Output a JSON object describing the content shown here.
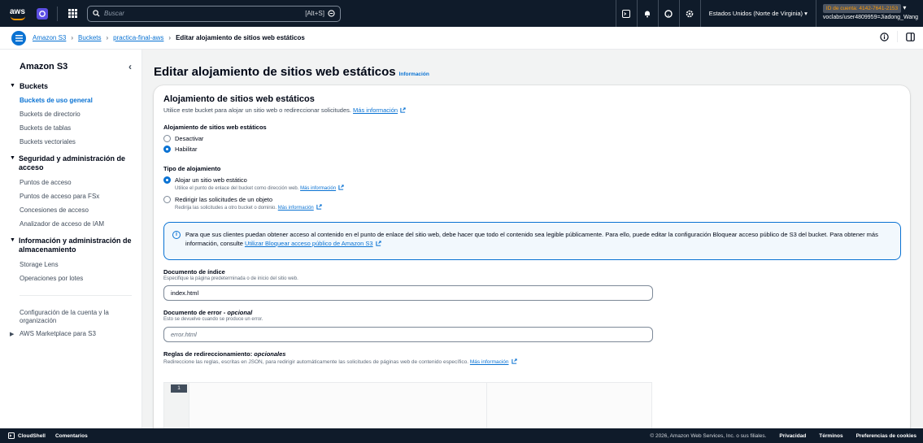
{
  "topbar": {
    "logo": "aws",
    "search_placeholder": "Buscar",
    "search_shortcut": "[Alt+S]",
    "region": "Estados Unidos (Norte de Virginia)",
    "account_id": "ID de cuenta: 4142-7641-2153",
    "account_user": "voclabs/user4809959=Jiadong_Wang"
  },
  "breadcrumb": {
    "items": [
      "Amazon S3",
      "Buckets",
      "practica-final-aws"
    ],
    "current": "Editar alojamiento de sitios web estáticos"
  },
  "sidebar": {
    "title": "Amazon S3",
    "sections": [
      {
        "label": "Buckets",
        "items": [
          "Buckets de uso general",
          "Buckets de directorio",
          "Buckets de tablas",
          "Buckets vectoriales"
        ]
      },
      {
        "label": "Seguridad y administración de acceso",
        "items": [
          "Puntos de acceso",
          "Puntos de acceso para FSx",
          "Concesiones de acceso",
          "Analizador de acceso de IAM"
        ]
      },
      {
        "label": "Información y administración de almacenamiento",
        "items": [
          "Storage Lens",
          "Operaciones por lotes"
        ]
      }
    ],
    "account_config": "Configuración de la cuenta y la organización",
    "marketplace": "AWS Marketplace para S3"
  },
  "main": {
    "page_title": "Editar alojamiento de sitios web estáticos",
    "info_link": "Información",
    "container": {
      "title": "Alojamiento de sitios web estáticos",
      "description": "Utilice este bucket para alojar un sitio web o redireccionar solicitudes.",
      "more_info": "Más información",
      "hosting_label": "Alojamiento de sitios web estáticos",
      "hosting_options": [
        "Desactivar",
        "Habilitar"
      ],
      "hosting_selected": "Habilitar",
      "type_label": "Tipo de alojamiento",
      "type_options": [
        {
          "label": "Alojar un sitio web estático",
          "desc": "Utilice el punto de enlace del bucket como dirección web.",
          "link": "Más información"
        },
        {
          "label": "Redirigir las solicitudes de un objeto",
          "desc": "Redirija las solicitudes a otro bucket o dominio.",
          "link": "Más información"
        }
      ],
      "type_selected": "Alojar un sitio web estático",
      "alert_text": "Para que sus clientes puedan obtener acceso al contenido en el punto de enlace del sitio web, debe hacer que todo el contenido sea legible públicamente. Para ello, puede editar la configuración Bloquear acceso público de S3 del bucket. Para obtener más información, consulte",
      "alert_link": "Utilizar Bloquear acceso público de Amazon S3",
      "index_label": "Documento de índice",
      "index_desc": "Especifique la página predeterminada o de inicio del sitio web.",
      "index_value": "index.html",
      "error_label": "Documento de error",
      "error_optional": "opcional",
      "error_desc": "Esto se devuelve cuando se produce un error.",
      "error_placeholder": "error.html",
      "rules_label": "Reglas de redireccionamiento:",
      "rules_optional": "opcionales",
      "rules_desc": "Redireccione las reglas, escritas en JSON, para redirigir automáticamente las solicitudes de páginas web de contenido específico.",
      "rules_link": "Más información",
      "editor_line": "1"
    }
  },
  "footer": {
    "cloudshell": "CloudShell",
    "feedback": "Comentarios",
    "copyright": "© 2026, Amazon Web Services, Inc. o sus filiales.",
    "privacy": "Privacidad",
    "terms": "Términos",
    "cookies": "Preferencias de cookies"
  },
  "colors": {
    "accent": "#0972d3",
    "header_bg": "#0f1b2a",
    "orange": "#ff9900"
  }
}
